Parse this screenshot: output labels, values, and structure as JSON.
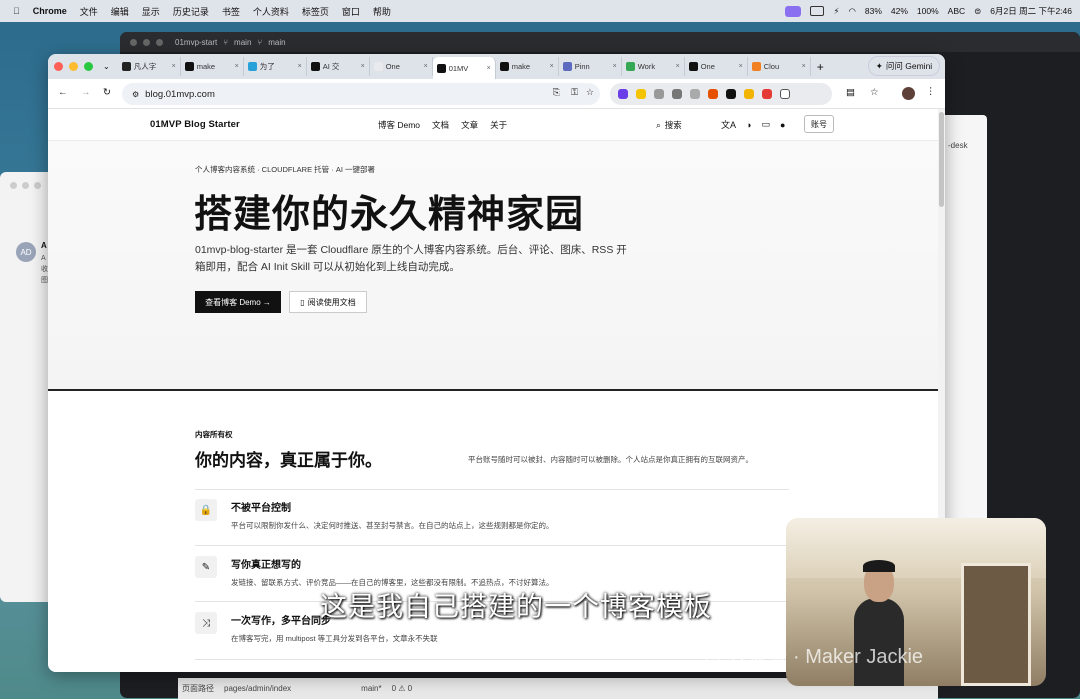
{
  "menubar": {
    "app": "Chrome",
    "items": [
      "文件",
      "编辑",
      "显示",
      "历史记录",
      "书签",
      "个人资料",
      "标签页",
      "窗口",
      "帮助"
    ],
    "mem": "83%",
    "cpu": "42%",
    "battery": "100%",
    "input": "ABC",
    "datetime": "6月2日 周二  下午2:46"
  },
  "terminal": {
    "tab": "01mvp-start",
    "branch1": "main",
    "branch2": "main",
    "right_label": "-desk"
  },
  "status_bar": {
    "path_label": "页面路径",
    "path": "pages/admin/index",
    "branch": "main*",
    "counts": "0 ⚠ 0"
  },
  "browser": {
    "tabs": [
      {
        "label": "凡人字",
        "color": "#222"
      },
      {
        "label": "make",
        "color": "#111"
      },
      {
        "label": "为了",
        "color": "#28a0d8"
      },
      {
        "label": "AI 交",
        "color": "#111"
      },
      {
        "label": "One",
        "color": "#e8eaed"
      },
      {
        "label": "01MV",
        "color": "#111",
        "active": true
      },
      {
        "label": "make",
        "color": "#111"
      },
      {
        "label": "Pinn",
        "color": "#5c6bc0"
      },
      {
        "label": "Work",
        "color": "#34a853"
      },
      {
        "label": "One",
        "color": "#111"
      },
      {
        "label": "Clou",
        "color": "#f38020"
      }
    ],
    "new_tab": "+",
    "url": "blog.01mvp.com",
    "gemini": "问问 Gemini"
  },
  "site": {
    "brand": "01MVP Blog Starter",
    "nav": [
      "博客 Demo",
      "文档",
      "文章",
      "关于"
    ],
    "search": "搜索",
    "account": "账号",
    "kicker": "个人博客内容系统 · CLOUDFLARE 托管 · AI 一键部署",
    "title": "搭建你的永久精神家园",
    "desc": "01mvp-blog-starter 是一套 Cloudflare 原生的个人博客内容系统。后台、评论、图床、RSS 开箱即用，配合 AI Init Skill 可以从初始化到上线自动完成。",
    "btn_demo": "查看博客 Demo →",
    "btn_docs": "阅读使用文档",
    "own_label": "内容所有权",
    "own_title": "你的内容，真正属于你。",
    "own_note": "平台账号随时可以被封、内容随时可以被删除。个人站点是你真正拥有的互联网资产。",
    "features": [
      {
        "icon": "lock-icon",
        "glyph": "🔒",
        "title": "不被平台控制",
        "desc": "平台可以限制你发什么、决定何时推送、甚至封号禁言。在自己的站点上，这些规则都是你定的。"
      },
      {
        "icon": "pencil-icon",
        "glyph": "✎",
        "title": "写你真正想写的",
        "desc": "发链接、留联系方式、评价竞品——在自己的博客里，这些都没有限制。不追热点，不讨好算法。"
      },
      {
        "icon": "share-icon",
        "glyph": "⤨",
        "title": "一次写作，多平台同步",
        "desc": "在博客写完，用 multipost 等工具分发到各平台，文章永不失联"
      }
    ]
  },
  "overlay": {
    "subtitle": "这是我自己搭建的一个博客模板",
    "watermark": "公众号 · Maker Jackie"
  },
  "left_window": {
    "avatar": "AD",
    "letter": "A",
    "lines": [
      "A",
      "收",
      "图"
    ]
  }
}
